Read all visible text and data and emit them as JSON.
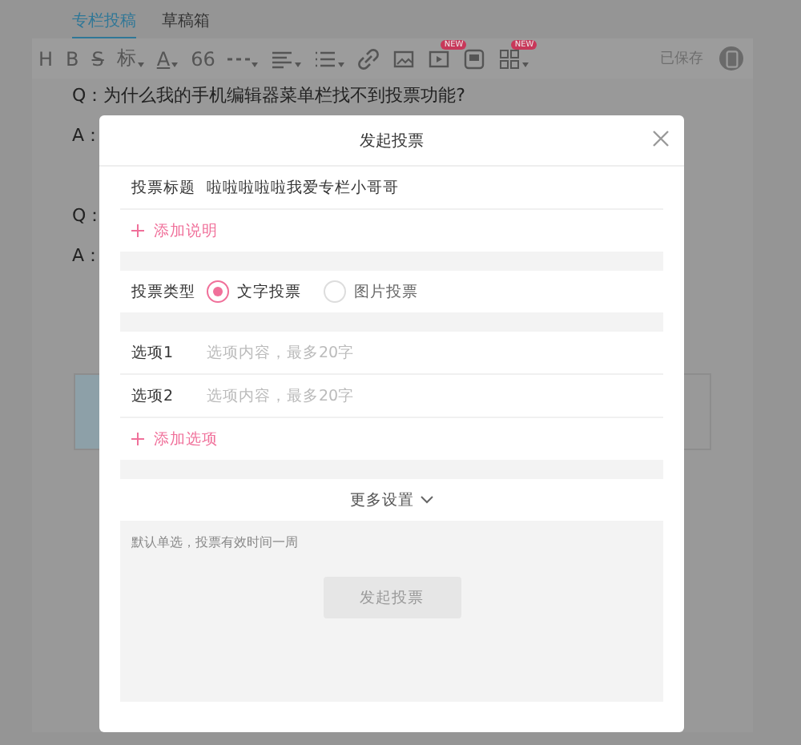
{
  "tabs": [
    {
      "label": "专栏投稿",
      "selected": true
    },
    {
      "label": "草稿箱",
      "selected": false
    }
  ],
  "toolbar": {
    "items": [
      {
        "kind": "text",
        "label": "H",
        "dropdown": false
      },
      {
        "kind": "text",
        "label": "B",
        "dropdown": false
      },
      {
        "kind": "text",
        "label": "S",
        "dropdown": false
      },
      {
        "kind": "text",
        "label": "标",
        "dropdown": true
      },
      {
        "kind": "text",
        "label": "A",
        "dropdown": true
      },
      {
        "kind": "text",
        "label": "66",
        "dropdown": false
      },
      {
        "kind": "icon",
        "dropdown": true
      },
      {
        "kind": "icon",
        "dropdown": true
      },
      {
        "kind": "icon",
        "dropdown": true
      },
      {
        "kind": "icon",
        "dropdown": false
      },
      {
        "kind": "icon",
        "dropdown": false
      },
      {
        "kind": "icon",
        "dropdown": false,
        "badge": "NEW"
      },
      {
        "kind": "icon",
        "dropdown": false
      },
      {
        "kind": "icon",
        "dropdown": true,
        "badge": "NEW"
      }
    ],
    "save_status": "已保存"
  },
  "editor": {
    "lines": [
      {
        "text": "Q：为什么我的手机编辑器菜单栏找不到投票功能?"
      },
      {
        "text": "A："
      },
      {
        "text": "Q："
      },
      {
        "text": "A："
      }
    ]
  },
  "modal": {
    "title": "发起投票",
    "title_field": {
      "label": "投票标题",
      "value": "啦啦啦啦啦我爱专栏小哥哥"
    },
    "add_description": "添加说明",
    "vote_type": {
      "label": "投票类型",
      "options": [
        {
          "label": "文字投票",
          "selected": true
        },
        {
          "label": "图片投票",
          "selected": false
        }
      ]
    },
    "options": [
      {
        "label": "选项1",
        "placeholder": "选项内容，最多20字"
      },
      {
        "label": "选项2",
        "placeholder": "选项内容，最多20字"
      }
    ],
    "add_option": "添加选项",
    "more_settings": "更多设置",
    "note": "默认单选，投票有效时间一周",
    "submit": {
      "label": "发起投票",
      "disabled": true
    }
  }
}
